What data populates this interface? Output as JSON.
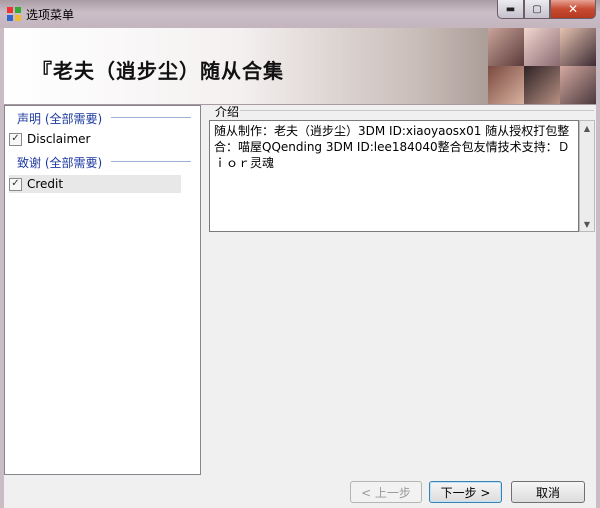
{
  "window": {
    "title": "选项菜单",
    "min_glyph": "▬",
    "max_glyph": "▢",
    "close_glyph": "✕"
  },
  "banner": {
    "title": "『老夫（逍步尘）随从合集"
  },
  "left_pane": {
    "groups": [
      {
        "header": "声明 (全部需要)",
        "items": [
          {
            "label": "Disclaimer",
            "checked": true,
            "check_glyph": "✓"
          }
        ]
      },
      {
        "header": "致谢 (全部需要)",
        "items": [
          {
            "label": "Credit",
            "checked": true,
            "check_glyph": "✓"
          }
        ]
      }
    ]
  },
  "description": {
    "label": "介绍",
    "text": "随从制作：老夫（逍步尘）3DM ID:xiaoyaosx01 随从授权打包整合：喵屋QQending 3DM ID:lee184040整合包友情技术支持：Ｄｉｏｒ灵魂",
    "scroll_up_glyph": "▲",
    "scroll_down_glyph": "▼"
  },
  "buttons": {
    "prev": "< 上一步",
    "next": "下一步 >",
    "cancel": "取消"
  },
  "colors": {
    "group_header": "#1e3aa0",
    "accent_close": "#c74a30"
  }
}
